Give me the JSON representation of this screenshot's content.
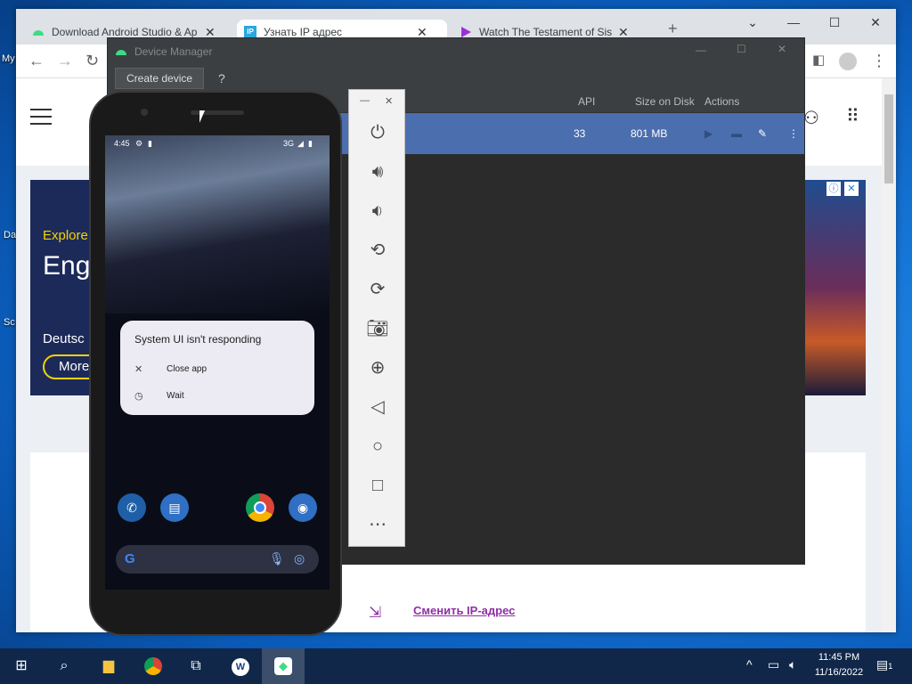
{
  "desktop": {
    "labels": [
      "My",
      "Da",
      "Sc"
    ]
  },
  "chrome": {
    "tabs": [
      {
        "title": "Download Android Studio & Ap",
        "icon": "android-icon"
      },
      {
        "title": "Узнать IP адрес",
        "icon": "ip-icon"
      },
      {
        "title": "Watch The Testament of Sis",
        "icon": "play-icon"
      }
    ],
    "page": {
      "ad_line1": "Explore",
      "ad_line2": "Eng",
      "ad_line3": "Deutsc",
      "ad_button": "More",
      "link_text": "Сменить IP-адрес"
    }
  },
  "device_manager": {
    "title": "Device Manager",
    "create_button": "Create device",
    "help": "?",
    "columns": {
      "api": "API",
      "size": "Size on Disk",
      "actions": "Actions"
    },
    "row": {
      "api": "33",
      "size": "801 MB"
    }
  },
  "phone": {
    "status_time": "4:45",
    "status_net": "3G",
    "dialog": {
      "title": "System UI isn't responding",
      "option1": "Close app",
      "option2": "Wait"
    }
  },
  "taskbar": {
    "time": "11:45 PM",
    "date": "11/16/2022",
    "notifications": "1"
  }
}
